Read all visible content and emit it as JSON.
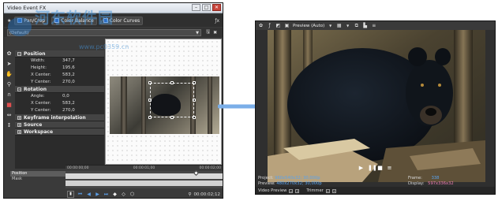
{
  "fx_window": {
    "title": "Video Event FX",
    "plugin_chain": [
      "Pan/Crop",
      "Color Balance",
      "Color Curves"
    ],
    "preset_value": "(Default)",
    "sections": {
      "position": {
        "label": "Position",
        "rows": [
          {
            "label": "Width:",
            "value": "347,7"
          },
          {
            "label": "Height:",
            "value": "195,6"
          },
          {
            "label": "X Center:",
            "value": "583,2"
          },
          {
            "label": "Y Center:",
            "value": "270,0"
          }
        ]
      },
      "rotation": {
        "label": "Rotation",
        "rows": [
          {
            "label": "Angle:",
            "value": "0,0"
          },
          {
            "label": "X Center:",
            "value": "583,2"
          },
          {
            "label": "Y Center:",
            "value": "270,0"
          }
        ]
      },
      "keyframe": {
        "label": "Keyframe interpolation"
      },
      "source": {
        "label": "Source"
      },
      "workspace": {
        "label": "Workspace"
      }
    },
    "tracks": [
      "Position",
      "Mask"
    ],
    "ruler_ticks": [
      "00:00:00;00",
      "00:00:01;00",
      "00:00:02;00"
    ],
    "timecode": "00:00:02;12"
  },
  "preview_window": {
    "toolbar_label": "Preview (Auto)",
    "info": {
      "project_label": "Project:",
      "project_value": "960x540x32; 30,000p",
      "preview_label": "Preview:",
      "preview_value": "480x270x32; 30,000p",
      "frame_label": "Frame:",
      "frame_value": "338",
      "display_label": "Display:",
      "display_value": "597x336x32"
    },
    "tabs": [
      "Video Preview",
      "Trimmer"
    ]
  },
  "watermark": {
    "brand": "河东软件园",
    "url": "www.pc0359.cn"
  },
  "colors": {
    "arrow": "#7aaee8",
    "info_value": "#5aa3ee",
    "display_value": "#f27fb6"
  }
}
